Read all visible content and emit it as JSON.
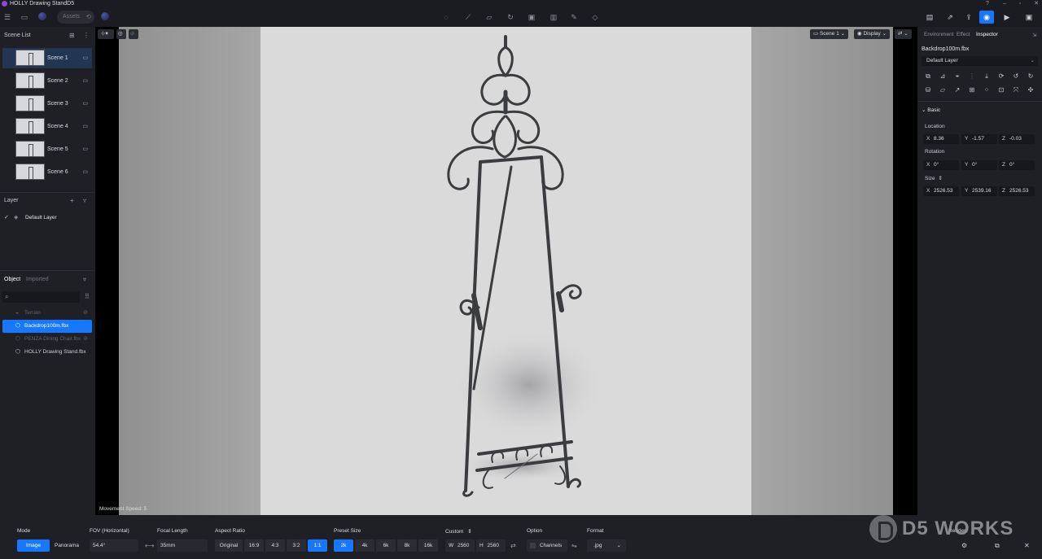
{
  "window": {
    "title": "HOLLY Drawing StandD5",
    "controls": [
      "?",
      "–",
      "▫",
      "✕"
    ]
  },
  "toolbar": {
    "assets_label": "Assets"
  },
  "scene_list": {
    "title": "Scene List",
    "scenes": [
      "Scene 1",
      "Scene 2",
      "Scene 3",
      "Scene 4",
      "Scene 5",
      "Scene 6"
    ]
  },
  "layer": {
    "title": "Layer",
    "default_layer": "Default Layer"
  },
  "objects": {
    "tabs": [
      "Object",
      "Imported"
    ],
    "items": [
      {
        "label": "Terrain",
        "state": "hidden"
      },
      {
        "label": "Backdrop100m.fbx",
        "state": "selected"
      },
      {
        "label": "PENZA Dining Chair.fbx",
        "state": "hidden"
      },
      {
        "label": "HOLLY Drawing Stand.fbx",
        "state": "normal"
      }
    ]
  },
  "viewport": {
    "scene_dropdown": "Scene 1",
    "display_dropdown": "Display",
    "movement_speed": "Movement Speed: 5"
  },
  "inspector": {
    "tabs": [
      "Environment",
      "Effect",
      "Inspector"
    ],
    "object_name": "Backdrop100m.fbx",
    "layer_select": "Default Layer",
    "section": "Basic",
    "location_label": "Location",
    "location": {
      "x": "8.36",
      "y": "-1.57",
      "z": "-0.03"
    },
    "rotation_label": "Rotation",
    "rotation": {
      "x": "0°",
      "y": "0°",
      "z": "0°"
    },
    "size_label": "Size",
    "size": {
      "x": "2526.53",
      "y": "2539.16",
      "z": "2526.53"
    }
  },
  "bottom": {
    "mode_label": "Mode",
    "mode_image": "Image",
    "mode_panorama": "Panorama",
    "fov_label": "FOV (Horizontal)",
    "fov_value": "54.4°",
    "focal_label": "Focal Length",
    "focal_value": "35mm",
    "aspect_label": "Aspect Ratio",
    "aspect": [
      "Original",
      "16:9",
      "4:3",
      "3:2",
      "1:1"
    ],
    "preset_label": "Preset Size",
    "presets": [
      "2k",
      "4k",
      "6k",
      "8k",
      "16k"
    ],
    "custom_label": "Custom",
    "custom_w_label": "W",
    "custom_w": "2560",
    "custom_h_label": "H",
    "custom_h": "2560",
    "option_label": "Option",
    "channels_label": "Channels",
    "format_label": "Format",
    "format_value": ".jpg",
    "render_label": "Render"
  },
  "watermark": {
    "text": "D5 WORKS"
  },
  "colors": {
    "accent": "#1677ff",
    "panel": "#1e2026",
    "app_bg": "#16181d"
  }
}
